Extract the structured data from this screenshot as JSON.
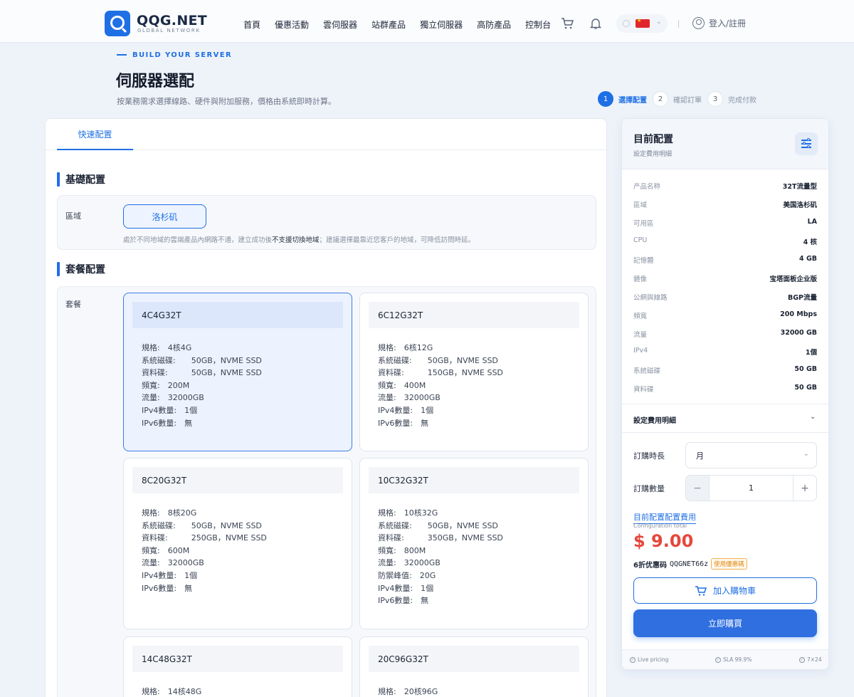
{
  "header": {
    "logo_text": "QQG.NET",
    "logo_sub": "GLOBAL NETWORK",
    "nav": [
      "首頁",
      "優惠活動",
      "雲伺服器",
      "站群產品",
      "獨立伺服器",
      "高防產品",
      "控制台"
    ],
    "login_label": "登入/註冊"
  },
  "page": {
    "kicker": "BUILD YOUR SERVER",
    "title": "伺服器選配",
    "description": "按業務需求選擇線路、硬件與附加服務，價格由系統即時計算。",
    "steps": [
      {
        "num": "1",
        "label": "選擇配置"
      },
      {
        "num": "2",
        "label": "確認訂單"
      },
      {
        "num": "3",
        "label": "完成付款"
      }
    ]
  },
  "main": {
    "tab_label": "快速配置",
    "basic_section_title": "基礎配置",
    "region_label": "區域",
    "region_value": "洛杉矶",
    "region_note_pre": "處於不同地域的雲端產品內網路不通，建立成功後",
    "region_note_bold": "不支援切換地域",
    "region_note_post": "；建議選擇最靠近您客戶的地域，可降低訪問時延。",
    "plan_section_title": "套餐配置",
    "plan_label": "套餐",
    "plans": [
      {
        "name": "4C4G32T",
        "specs": [
          "規格:　4核4G",
          "系統磁碟:　　50GB，NVME SSD",
          "資料碟:　　　50GB，NVME SSD",
          "頻寬:　200M",
          "流量:　32000GB",
          "IPv4數量:　1個",
          "IPv6數量:　無"
        ]
      },
      {
        "name": "6C12G32T",
        "specs": [
          "規格:　6核12G",
          "系統磁碟:　　50GB，NVME SSD",
          "資料碟:　　　150GB，NVME SSD",
          "頻寬:　400M",
          "流量:　32000GB",
          "IPv4數量:　1個",
          "IPv6數量:　無"
        ]
      },
      {
        "name": "8C20G32T",
        "specs": [
          "規格:　8核20G",
          "系統磁碟:　　50GB，NVME SSD",
          "資料碟:　　　250GB，NVME SSD",
          "頻寬:　600M",
          "流量:　32000GB",
          "IPv4數量:　1個",
          "IPv6數量:　無"
        ]
      },
      {
        "name": "10C32G32T",
        "specs": [
          "規格:　10核32G",
          "系統磁碟:　　50GB，NVME SSD",
          "資料碟:　　　350GB，NVME SSD",
          "頻寬:　800M",
          "流量:　32000GB",
          "防禦峰值:　20G",
          "IPv4數量:　1個",
          "IPv6數量:　無"
        ]
      },
      {
        "name": "14C48G32T",
        "specs": [
          "規格:　14核48G"
        ]
      },
      {
        "name": "20C96G32T",
        "specs": [
          "規格:　20核96G"
        ]
      }
    ]
  },
  "summary": {
    "title": "目前配置",
    "subtitle": "設定費用明細",
    "items": [
      {
        "k": "产品名称",
        "v": "32T流量型"
      },
      {
        "k": "區域",
        "v": "美国洛杉矶"
      },
      {
        "k": "可用區",
        "v": "LA"
      },
      {
        "k": "CPU",
        "v": "4 核"
      },
      {
        "k": "記憶體",
        "v": "4 GB"
      },
      {
        "k": "鏡像",
        "v": "宝塔面板企业版"
      },
      {
        "k": "公網與線路",
        "v": "BGP流量"
      },
      {
        "k": "頻寬",
        "v": "200 Mbps"
      },
      {
        "k": "流量",
        "v": "32000 GB"
      },
      {
        "k": "IPv4",
        "v": "1個"
      },
      {
        "k": "系統磁碟",
        "v": "50 GB"
      },
      {
        "k": "資料碟",
        "v": "50 GB"
      }
    ],
    "detail_toggle": "設定費用明細",
    "duration_label": "訂購時長",
    "duration_value": "月",
    "quantity_label": "訂購數量",
    "quantity_value": "1",
    "total_label": "目前配置配置費用",
    "total_en": "Configuration total",
    "price": "$ 9.00",
    "promo_text": "6折优惠码",
    "promo_code": "QQGNET66z",
    "promo_tag": "使用優惠碼",
    "add_cart_label": "加入購物車",
    "buy_label": "立即購買",
    "footer": [
      "Live pricing",
      "SLA 99.9%",
      "7×24"
    ]
  },
  "colors": {
    "accent": "#1f6fe5",
    "price": "#e5473a",
    "promo": "#e08a14"
  }
}
